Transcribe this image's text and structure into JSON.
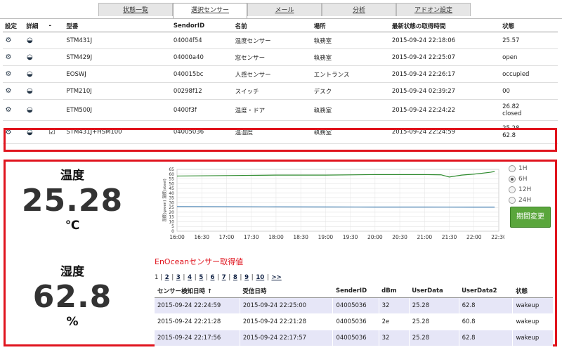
{
  "tabs": [
    {
      "label": "状態一覧",
      "active": false
    },
    {
      "label": "選択センサー",
      "active": true
    },
    {
      "label": "メール",
      "active": false
    },
    {
      "label": "分析",
      "active": false
    },
    {
      "label": "アドオン設定",
      "active": false
    }
  ],
  "sensor_table": {
    "headers": [
      "設定",
      "詳細",
      "-",
      "型番",
      "SendorID",
      "名前",
      "場所",
      "最新状態の取得時間",
      "状態"
    ],
    "rows": [
      {
        "model": "STM431J",
        "id": "04004f54",
        "name": "温度センサー",
        "place": "執務室",
        "time": "2015-09-24 22:18:06",
        "state": "25.57",
        "state2": "",
        "checked": false
      },
      {
        "model": "STM429J",
        "id": "04000a40",
        "name": "窓センサー",
        "place": "執務室",
        "time": "2015-09-24 22:25:07",
        "state": "open",
        "state2": "",
        "checked": false
      },
      {
        "model": "EOSWJ",
        "id": "040015bc",
        "name": "人感センサー",
        "place": "エントランス",
        "time": "2015-09-24 22:26:17",
        "state": "occupied",
        "state2": "",
        "checked": false
      },
      {
        "model": "PTM210J",
        "id": "00298f12",
        "name": "スイッチ",
        "place": "デスク",
        "time": "2015-09-24 02:39:27",
        "state": "00",
        "state2": "",
        "checked": false
      },
      {
        "model": "ETM500J",
        "id": "0400f3f",
        "name": "温度・ドア",
        "place": "執務室",
        "time": "2015-09-24 22:24:22",
        "state": "26.82",
        "state2": "closed",
        "checked": false
      },
      {
        "model": "STM431J+HSM100",
        "id": "04005036",
        "name": "温湿度",
        "place": "執務室",
        "time": "2015-09-24 22:24:59",
        "state": "25.28",
        "state2": "62.8",
        "checked": true
      }
    ]
  },
  "detail": {
    "temp_label": "温度",
    "temp_value": "25.28",
    "temp_unit": "℃",
    "hum_label": "湿度",
    "hum_value": "62.8",
    "hum_unit": "%"
  },
  "chart_data": {
    "type": "line",
    "ylabel": "湿度(green) 温度(steel)",
    "ylim": [
      0,
      65
    ],
    "yticks": [
      0,
      5,
      10,
      15,
      20,
      25,
      30,
      35,
      40,
      45,
      50,
      55,
      60,
      65
    ],
    "xticks": [
      "16:00",
      "16:30",
      "17:00",
      "17:30",
      "18:00",
      "18:30",
      "19:00",
      "19:30",
      "20:00",
      "20:30",
      "21:00",
      "21:30",
      "22:00",
      "22:30"
    ],
    "series": [
      {
        "color": "#2e8b2e",
        "x": [
          "16:00",
          "17:00",
          "18:00",
          "19:00",
          "20:00",
          "21:00",
          "21:20",
          "21:30",
          "21:45",
          "22:00",
          "22:10",
          "22:20",
          "22:25"
        ],
        "values": [
          58,
          58.5,
          59,
          59,
          59.5,
          59.5,
          59.3,
          57,
          59,
          60,
          61,
          62,
          62.8
        ]
      },
      {
        "color": "#4682b4",
        "x": [
          "16:00",
          "17:00",
          "18:00",
          "19:00",
          "20:00",
          "21:00",
          "22:00",
          "22:25"
        ],
        "values": [
          26,
          25.8,
          25.6,
          25.5,
          25.4,
          25.4,
          25.3,
          25.28
        ]
      }
    ]
  },
  "range": {
    "options": [
      "1H",
      "6H",
      "12H",
      "24H"
    ],
    "selected": "6H",
    "button": "期間変更"
  },
  "log": {
    "title": "EnOceanセンサー取得値",
    "pager_current": "1",
    "pages": [
      "2",
      "3",
      "4",
      "5",
      "6",
      "7",
      "8",
      "9",
      "10"
    ],
    "next": ">>",
    "headers": [
      "センサー検知日時 ↑",
      "受信日時",
      "SenderID",
      "dBm",
      "UserData",
      "UserData2",
      "状態"
    ],
    "rows": [
      [
        "2015-09-24 22:24:59",
        "2015-09-24 22:25:00",
        "04005036",
        "32",
        "25.28",
        "62.8",
        "wakeup"
      ],
      [
        "2015-09-24 22:21:28",
        "2015-09-24 22:21:28",
        "04005036",
        "2e",
        "25.28",
        "60.8",
        "wakeup"
      ],
      [
        "2015-09-24 22:17:56",
        "2015-09-24 22:17:57",
        "04005036",
        "32",
        "25.28",
        "62.8",
        "wakeup"
      ]
    ]
  }
}
